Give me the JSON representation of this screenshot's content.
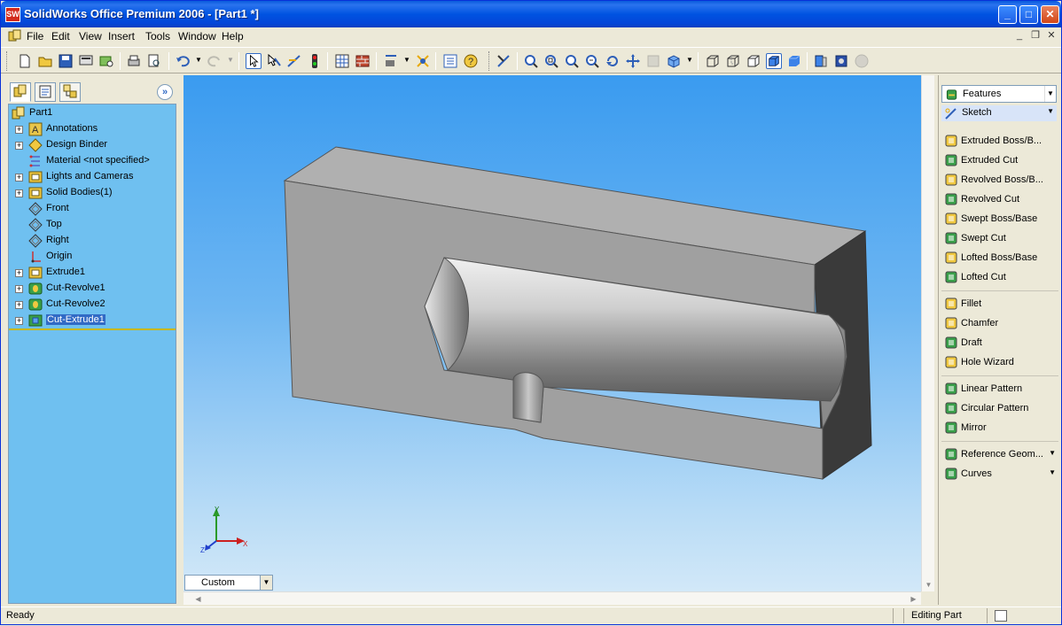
{
  "window": {
    "app_icon_text": "SW",
    "title": "SolidWorks Office Premium 2006 - [Part1 *]",
    "minimize": "_",
    "maximize": "□",
    "close": "✕"
  },
  "menu": {
    "items": [
      "File",
      "Edit",
      "View",
      "Insert",
      "Tools",
      "Window",
      "Help"
    ],
    "mdi_minimize": "_",
    "mdi_restore": "❐",
    "mdi_close": "✕"
  },
  "feature_tree": {
    "tabs": [
      "feature-manager",
      "property-manager",
      "configuration-manager"
    ],
    "expand_label": "»",
    "root": "Part1",
    "items": [
      {
        "label": "Annotations",
        "expandable": true,
        "icon": "annotations-icon",
        "color": "#e8c64a"
      },
      {
        "label": "Design Binder",
        "expandable": true,
        "icon": "design-binder-icon",
        "color": "#f0c840"
      },
      {
        "label": "Material <not specified>",
        "expandable": false,
        "icon": "material-icon",
        "color": "#5a7ad0"
      },
      {
        "label": "Lights and Cameras",
        "expandable": true,
        "icon": "lights-icon",
        "color": "#f0c840"
      },
      {
        "label": "Solid Bodies(1)",
        "expandable": true,
        "icon": "solid-bodies-icon",
        "color": "#f0c840"
      },
      {
        "label": "Front",
        "expandable": false,
        "icon": "plane-icon",
        "color": "#ffffff"
      },
      {
        "label": "Top",
        "expandable": false,
        "icon": "plane-icon",
        "color": "#ffffff"
      },
      {
        "label": "Right",
        "expandable": false,
        "icon": "plane-icon",
        "color": "#ffffff"
      },
      {
        "label": "Origin",
        "expandable": false,
        "icon": "origin-icon",
        "color": "#cc3333"
      },
      {
        "label": "Extrude1",
        "expandable": true,
        "icon": "extrude-icon",
        "color": "#f0c840"
      },
      {
        "label": "Cut-Revolve1",
        "expandable": true,
        "icon": "cut-revolve-icon",
        "color": "#3aa04a"
      },
      {
        "label": "Cut-Revolve2",
        "expandable": true,
        "icon": "cut-revolve-icon",
        "color": "#3aa04a"
      },
      {
        "label": "Cut-Extrude1",
        "expandable": true,
        "icon": "cut-extrude-icon",
        "color": "#3aa04a",
        "selected": true
      }
    ]
  },
  "graphics": {
    "view_orientation": "Custom",
    "axes": {
      "x": "X",
      "y": "Y",
      "z": "Z"
    }
  },
  "command_manager": {
    "toolbar_select": "Features",
    "sketch_label": "Sketch",
    "groups": [
      [
        {
          "label": "Extruded Boss/B...",
          "icon": "extruded-boss-icon"
        },
        {
          "label": "Extruded Cut",
          "icon": "extruded-cut-icon"
        },
        {
          "label": "Revolved Boss/B...",
          "icon": "revolved-boss-icon"
        },
        {
          "label": "Revolved Cut",
          "icon": "revolved-cut-icon"
        },
        {
          "label": "Swept Boss/Base",
          "icon": "swept-boss-icon"
        },
        {
          "label": "Swept Cut",
          "icon": "swept-cut-icon"
        },
        {
          "label": "Lofted Boss/Base",
          "icon": "lofted-boss-icon"
        },
        {
          "label": "Lofted Cut",
          "icon": "lofted-cut-icon"
        }
      ],
      [
        {
          "label": "Fillet",
          "icon": "fillet-icon"
        },
        {
          "label": "Chamfer",
          "icon": "chamfer-icon"
        },
        {
          "label": "Draft",
          "icon": "draft-icon"
        },
        {
          "label": "Hole Wizard",
          "icon": "hole-wizard-icon"
        }
      ],
      [
        {
          "label": "Linear Pattern",
          "icon": "linear-pattern-icon"
        },
        {
          "label": "Circular Pattern",
          "icon": "circular-pattern-icon"
        },
        {
          "label": "Mirror",
          "icon": "mirror-icon"
        }
      ],
      [
        {
          "label": "Reference Geom...",
          "icon": "reference-geometry-icon",
          "dropdown": true
        },
        {
          "label": "Curves",
          "icon": "curves-icon",
          "dropdown": true
        }
      ]
    ]
  },
  "status": {
    "left": "Ready",
    "mode": "Editing Part"
  },
  "colors": {
    "tree_bg": "#6fc0f0",
    "selection": "#316ac5",
    "title_bar": "#0053e1"
  }
}
